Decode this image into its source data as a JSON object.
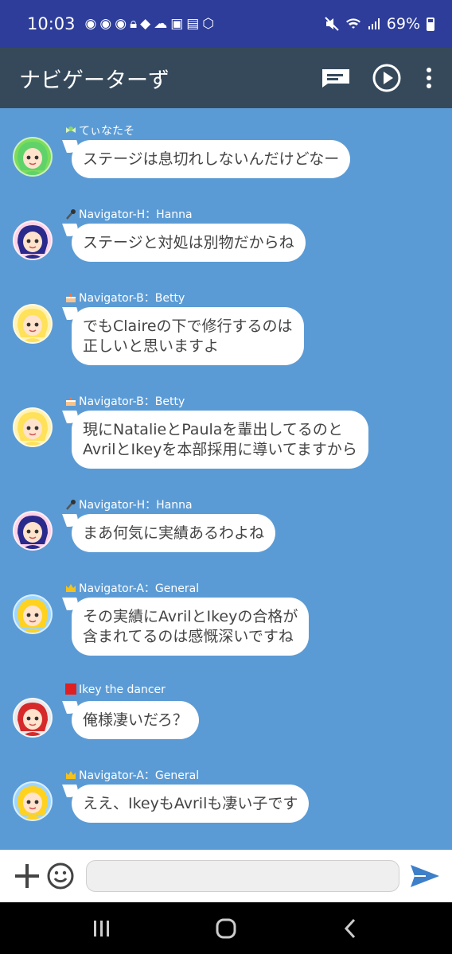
{
  "status": {
    "time": "10:03",
    "battery": "69%",
    "icons": [
      "discord-icon",
      "discord-icon",
      "discord-icon",
      "lock-icon",
      "share-icon",
      "cloud-icon",
      "box-icon",
      "image-icon",
      "vpn-icon"
    ]
  },
  "header": {
    "title": "ナビゲーターず"
  },
  "messages": [
    {
      "sender": "てぃなたそ",
      "text": [
        "ステージは息切れしないんだけどなー"
      ],
      "avatar_color": "#7ddc5a",
      "hair": "#5fd36a",
      "sender_icon": "fairy-icon"
    },
    {
      "sender": "Navigator-H：Hanna",
      "text": [
        "ステージと対処は別物だからね"
      ],
      "avatar_color": "#ffd1e6",
      "hair": "#2a2a8c",
      "sender_icon": "microphone-icon"
    },
    {
      "sender": "Navigator-B：Betty",
      "text": [
        "でもClaireの下で修行するのは",
        "正しいと思いますよ"
      ],
      "avatar_color": "#fff2b3",
      "hair": "#ffe15a",
      "sender_icon": "cake-icon"
    },
    {
      "sender": "Navigator-B：Betty",
      "text": [
        "現にNatalieとPaulaを輩出してるのと",
        "AvrilとIkeyを本部採用に導いてますから"
      ],
      "avatar_color": "#fff2b3",
      "hair": "#ffe15a",
      "sender_icon": "cake-icon"
    },
    {
      "sender": "Navigator-H：Hanna",
      "text": [
        "まあ何気に実績あるわよね"
      ],
      "avatar_color": "#ffd1e6",
      "hair": "#2a2a8c",
      "sender_icon": "microphone-icon"
    },
    {
      "sender": "Navigator-A：General",
      "text": [
        "その実績にAvrilとIkeyの合格が",
        "含まれてるのは感慨深いですね"
      ],
      "avatar_color": "#9fd6ff",
      "hair": "#ffd21f",
      "sender_icon": "crown-icon"
    },
    {
      "sender": "Ikey the dancer",
      "text": [
        "俺様凄いだろ？"
      ],
      "avatar_color": "#e8e8e8",
      "hair": "#d62a2a",
      "sender_icon": "red-square-icon"
    },
    {
      "sender": "Navigator-A：General",
      "text": [
        "ええ、IkeyもAvrilも凄い子です"
      ],
      "avatar_color": "#9fd6ff",
      "hair": "#ffd21f",
      "sender_icon": "crown-icon"
    }
  ],
  "input": {
    "value": "",
    "placeholder": ""
  },
  "colors": {
    "status_bar": "#2e3d99",
    "app_bar": "#36495b",
    "chat_bg": "#5b9bd5",
    "send": "#3d7fc9"
  }
}
